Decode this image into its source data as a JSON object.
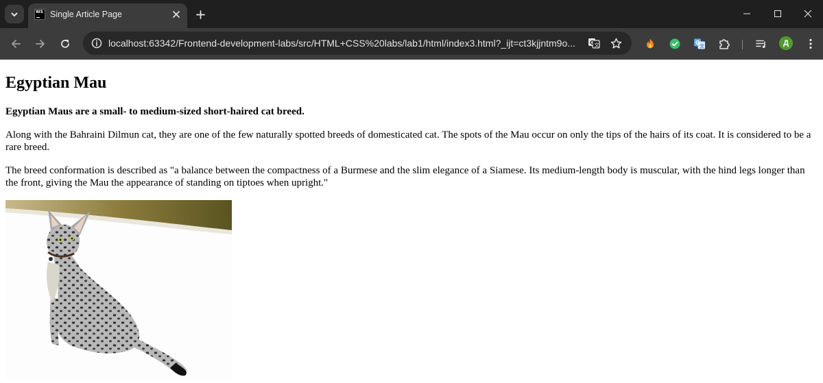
{
  "browser": {
    "tab": {
      "title": "Single Article Page",
      "favicon_text": "WS"
    },
    "address_bar": {
      "url": "localhost:63342/Frontend-development-labs/src/HTML+CSS%20labs/lab1/html/index3.html?_ijt=ct3kjjntm9o..."
    },
    "profile": {
      "initial": "Д",
      "color": "#4f9d2d"
    },
    "icons": {
      "tab_search": "chevron-down-icon",
      "close_tab": "close-icon",
      "new_tab": "plus-icon",
      "back": "arrow-left-icon",
      "forward": "arrow-right-icon",
      "reload": "reload-icon",
      "site_info": "info-icon",
      "translate": "translate-icon",
      "bookmark": "star-icon",
      "extensions": [
        "fire-extension-icon",
        "check-extension-icon",
        "translate-extension-icon",
        "puzzle-icon"
      ],
      "media": "playlist-icon",
      "menu": "kebab-menu-icon",
      "minimize": "minimize-icon",
      "maximize": "maximize-icon",
      "close_window": "close-window-icon"
    }
  },
  "article": {
    "title": "Egyptian Mau",
    "lead": "Egyptian Maus are a small- to medium-sized short-haired cat breed.",
    "paragraphs": [
      "Along with the Bahraini Dilmun cat, they are one of the few naturally spotted breeds of domesticated cat. The spots of the Mau occur on only the tips of the hairs of its coat. It is considered to be a rare breed.",
      "The breed conformation is described as \"a balance between the compactness of a Burmese and the slim elegance of a Siamese. Its medium-length body is muscular, with the hind legs longer than the front, giving the Mau the appearance of standing on tiptoes when upright.\""
    ],
    "image": {
      "subject": "cat-photo"
    }
  }
}
